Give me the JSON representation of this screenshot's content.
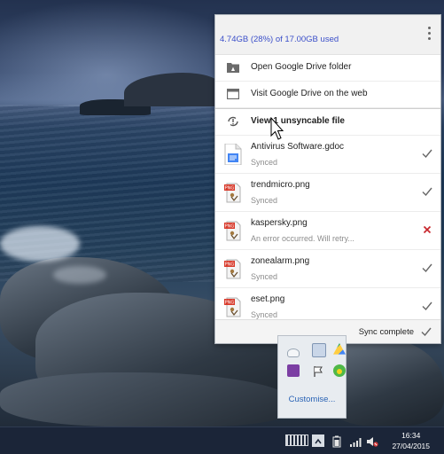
{
  "drive_panel": {
    "storage_usage": "4.74GB (28%) of 17.00GB used",
    "menu": {
      "open_folder": "Open Google Drive folder",
      "visit_web": "Visit Google Drive on the web",
      "unsyncable": "View 1 unsyncable file"
    },
    "files": [
      {
        "name": "Antivirus Software.gdoc",
        "status": "Synced",
        "type": "gdoc",
        "state": "synced"
      },
      {
        "name": "trendmicro.png",
        "status": "Synced",
        "type": "png",
        "state": "synced"
      },
      {
        "name": "kaspersky.png",
        "status": "An error occurred. Will retry...",
        "type": "png",
        "state": "error"
      },
      {
        "name": "zonealarm.png",
        "status": "Synced",
        "type": "png",
        "state": "synced"
      },
      {
        "name": "eset.png",
        "status": "Synced",
        "type": "png",
        "state": "synced"
      }
    ],
    "footer": "Sync complete",
    "file_type_badge": "PNG"
  },
  "tray_flyout": {
    "customise": "Customise..."
  },
  "taskbar": {
    "time": "16:34",
    "date": "27/04/2015"
  },
  "colors": {
    "usage_text": "#3b4fc9",
    "check": "#666666",
    "error_x": "#c8262c",
    "taskbar": "#1b2538",
    "link": "#2a63b5"
  }
}
